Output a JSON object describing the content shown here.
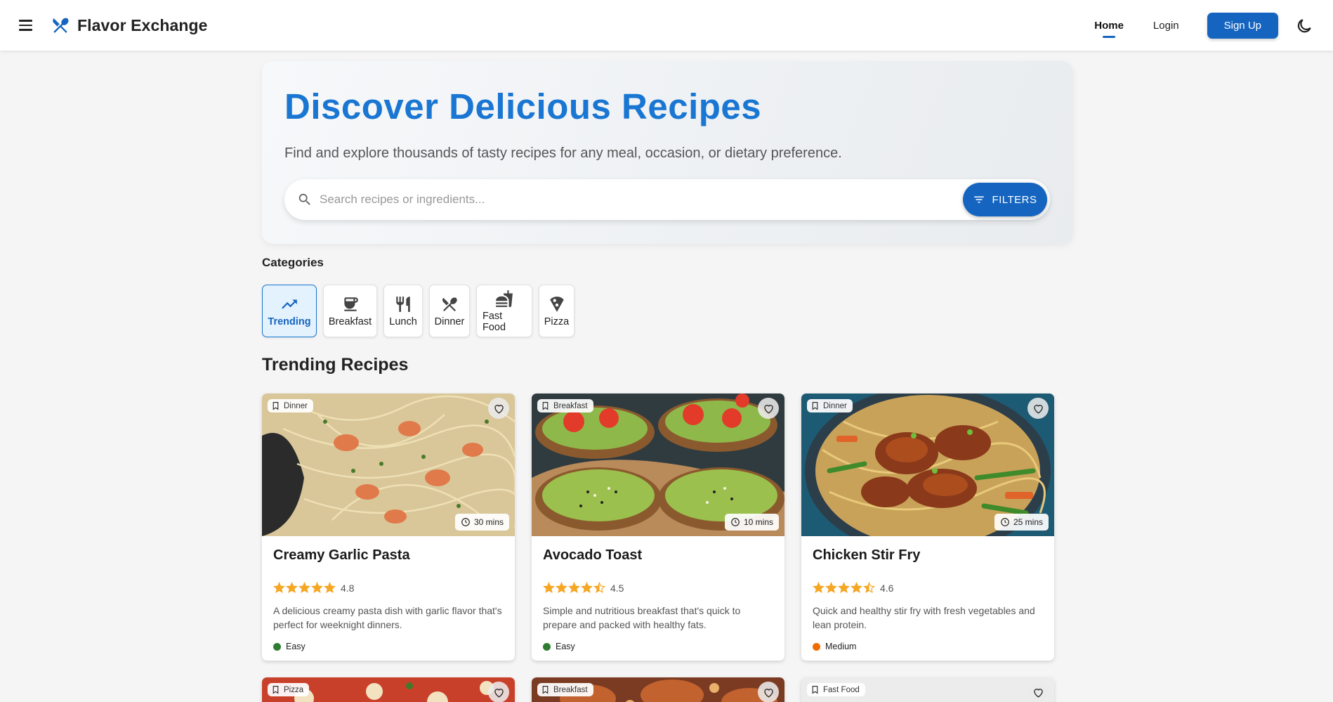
{
  "header": {
    "title": "Flavor Exchange",
    "nav": {
      "home": "Home",
      "login": "Login",
      "signup": "Sign Up"
    }
  },
  "hero": {
    "title": "Discover Delicious Recipes",
    "subtitle": "Find and explore thousands of tasty recipes for any meal, occasion, or dietary preference.",
    "search_placeholder": "Search recipes or ingredients...",
    "filters_label": "FILTERS"
  },
  "categories": {
    "heading": "Categories",
    "items": [
      {
        "label": "Trending",
        "icon": "trending-up-icon",
        "active": true
      },
      {
        "label": "Breakfast",
        "icon": "coffee-icon"
      },
      {
        "label": "Lunch",
        "icon": "restaurant-icon"
      },
      {
        "label": "Dinner",
        "icon": "dinner-icon"
      },
      {
        "label": "Fast Food",
        "icon": "fastfood-icon"
      },
      {
        "label": "Pizza",
        "icon": "pizza-icon"
      }
    ]
  },
  "section_title": "Trending Recipes",
  "recipes": [
    {
      "category": "Dinner",
      "time": "30 mins",
      "title": "Creamy Garlic Pasta",
      "rating": 4.8,
      "rating_text": "4.8",
      "description": "A delicious creamy pasta dish with garlic flavor that's perfect for weeknight dinners.",
      "difficulty": "Easy",
      "difficulty_color": "#2e7d32"
    },
    {
      "category": "Breakfast",
      "time": "10 mins",
      "title": "Avocado Toast",
      "rating": 4.5,
      "rating_text": "4.5",
      "description": "Simple and nutritious breakfast that's quick to prepare and packed with healthy fats.",
      "difficulty": "Easy",
      "difficulty_color": "#2e7d32"
    },
    {
      "category": "Dinner",
      "time": "25 mins",
      "title": "Chicken Stir Fry",
      "rating": 4.6,
      "rating_text": "4.6",
      "description": "Quick and healthy stir fry with fresh vegetables and lean protein.",
      "difficulty": "Medium",
      "difficulty_color": "#ef6c00"
    }
  ],
  "more_recipes": [
    {
      "category": "Pizza"
    },
    {
      "category": "Breakfast"
    },
    {
      "category": "Fast Food"
    }
  ],
  "colors": {
    "primary": "#1565c0",
    "hero_title": "#1976d2",
    "star": "#f5a623"
  }
}
